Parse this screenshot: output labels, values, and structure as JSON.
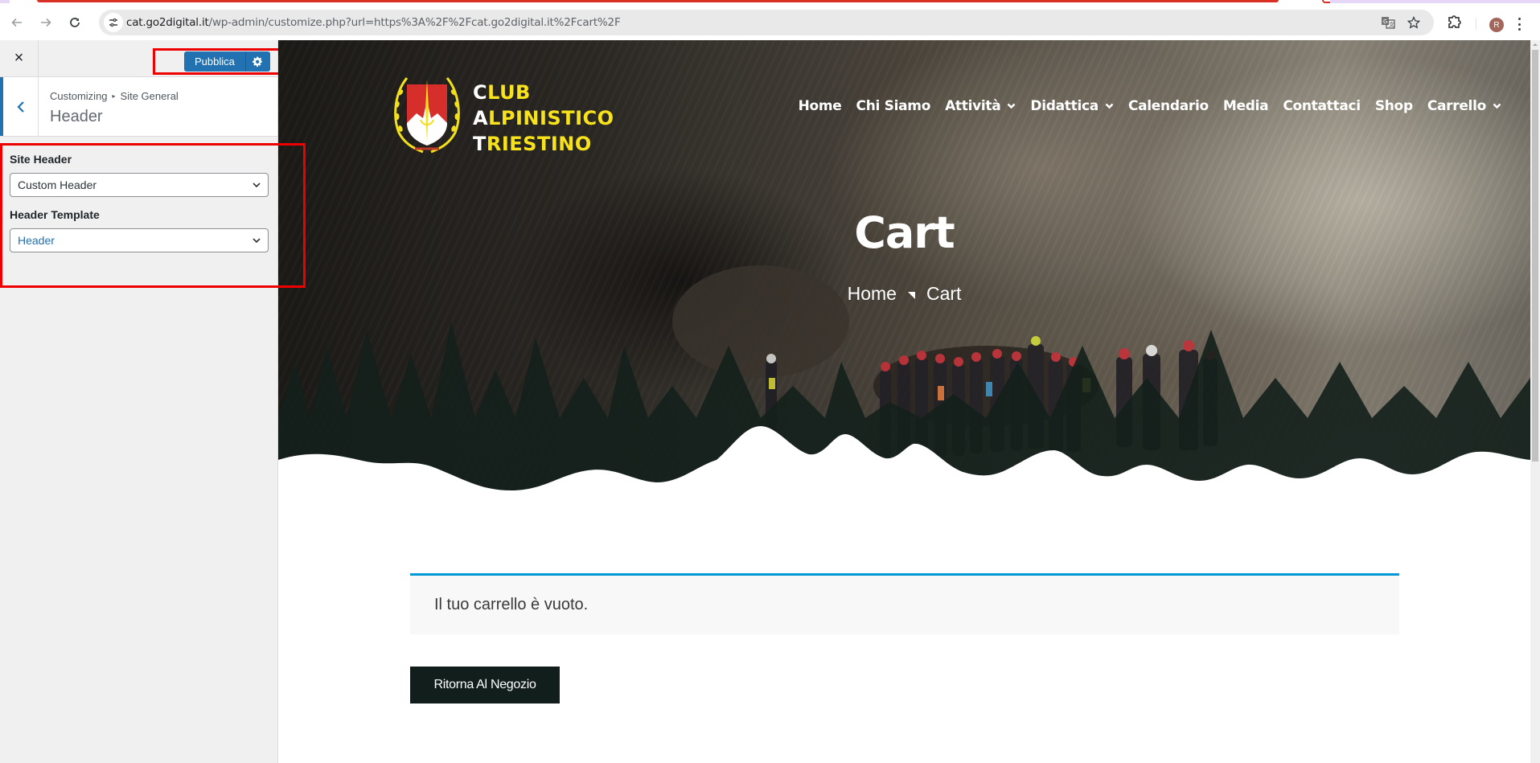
{
  "browser": {
    "url_host": "cat.go2digital.it",
    "url_rest": "/wp-admin/customize.php?url=https%3A%2F%2Fcat.go2digital.it%2Fcart%2F",
    "profile_initial": "R",
    "icons": {
      "back": "arrow-left-icon",
      "forward": "arrow-right-icon",
      "reload": "reload-icon",
      "site_info": "tune-icon",
      "translate": "translate-icon",
      "bookmark": "star-icon",
      "extensions": "puzzle-icon",
      "menu": "kebab-menu-icon"
    }
  },
  "customizer": {
    "close_label": "×",
    "publish_label": "Pubblica",
    "breadcrumb": {
      "root": "Customizing",
      "separator": "▸",
      "parent": "Site General"
    },
    "section_title": "Header",
    "controls": [
      {
        "label": "Site Header",
        "value": "Custom Header"
      },
      {
        "label": "Header Template",
        "value": "Header"
      }
    ],
    "accent_color": "#2271b1"
  },
  "site": {
    "logo": {
      "line1_first": "C",
      "line1_rest": "LUB",
      "line2_first": "A",
      "line2_rest": "LPINISTICO",
      "line3_first": "T",
      "line3_rest": "RIESTINO"
    },
    "nav": [
      {
        "label": "Home",
        "dropdown": false
      },
      {
        "label": "Chi Siamo",
        "dropdown": false
      },
      {
        "label": "Attività",
        "dropdown": true
      },
      {
        "label": "Didattica",
        "dropdown": true
      },
      {
        "label": "Calendario",
        "dropdown": false
      },
      {
        "label": "Media",
        "dropdown": false
      },
      {
        "label": "Contattaci",
        "dropdown": false
      },
      {
        "label": "Shop",
        "dropdown": false
      },
      {
        "label": "Carrello",
        "dropdown": true
      }
    ],
    "page_title": "Cart",
    "breadcrumbs": [
      "Home",
      "Cart"
    ],
    "cart_notice": "Il tuo carrello è vuoto.",
    "return_button": "Ritorna Al Negozio",
    "colors": {
      "logo_yellow": "#f7e21c",
      "notice_border": "#0099d6",
      "button_bg": "#121e1b",
      "forest": "#121e1b"
    }
  }
}
